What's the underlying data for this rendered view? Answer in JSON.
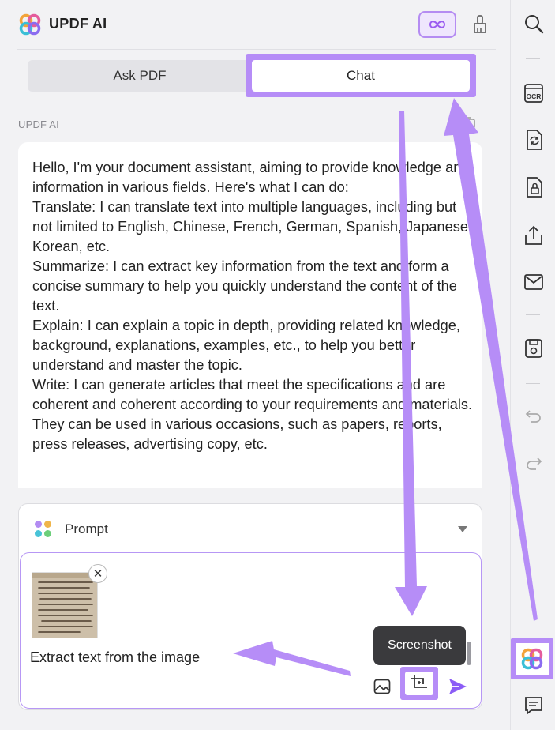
{
  "app": {
    "title": "UPDF AI"
  },
  "header": {
    "infinity_icon": "infinity-icon",
    "clear_icon": "brush-icon"
  },
  "tabs": [
    {
      "label": "Ask PDF",
      "selected": false
    },
    {
      "label": "Chat",
      "selected": true
    }
  ],
  "conversation": {
    "sender": "UPDF AI",
    "paragraphs": [
      "Hello, I'm your document assistant, aiming to provide knowledge and information in various fields. Here's what I can do:",
      "Translate: I can translate text into multiple languages, including but not limited to English, Chinese, French, German, Spanish, Japanese, Korean, etc.",
      "Summarize: I can extract key information from the text and form a concise summary to help you quickly understand the content of the text.",
      "Explain: I can explain a topic in depth, providing related knowledge, background, explanations, examples, etc., to help you better understand and master the topic.",
      "Write: I can generate articles that meet the specifications and are coherent and coherent according to your requirements and materials. They can be used in various occasions, such as papers, reports, press releases, advertising copy, etc."
    ]
  },
  "prompt": {
    "label": "Prompt"
  },
  "input": {
    "value": "Extract text from the image",
    "attachment_icon": "image-thumbnail",
    "remove_symbol": "✕"
  },
  "tooltip": {
    "text": "Screenshot"
  },
  "rail": {
    "icons": [
      "search-icon",
      "ocr-icon",
      "convert-icon",
      "protect-icon",
      "share-icon",
      "mail-icon",
      "save-icon",
      "undo-icon",
      "redo-icon",
      "updf-ai-icon",
      "comment-icon"
    ],
    "ocr_text": "OCR"
  },
  "colors": {
    "accent": "#b68df7",
    "highlight_border": "#b797f5",
    "send": "#8b5cf6"
  }
}
